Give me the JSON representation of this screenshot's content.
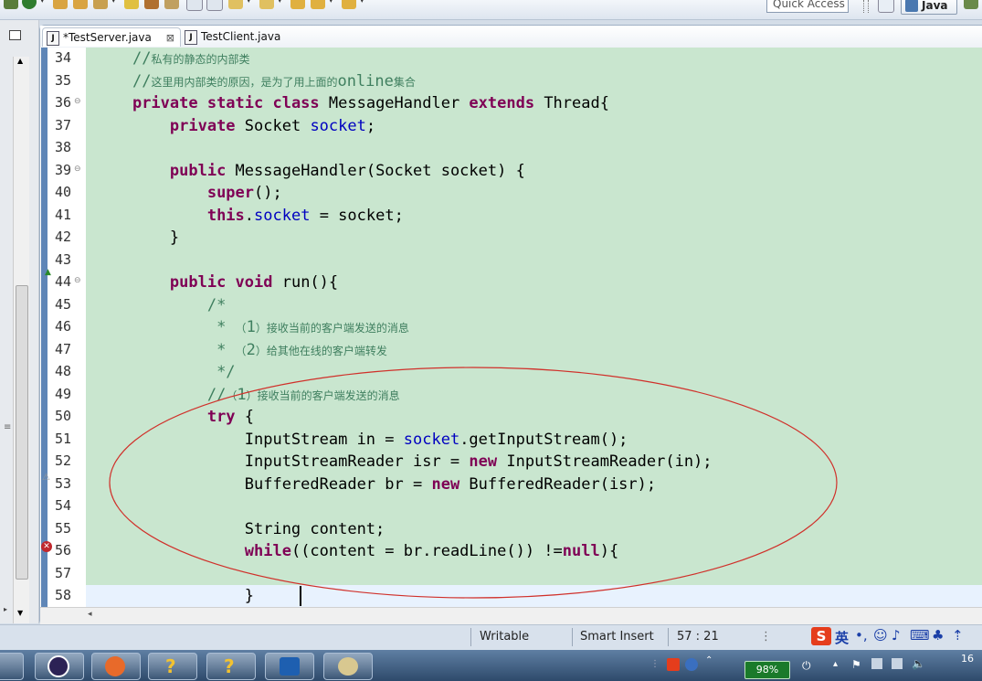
{
  "toolbar": {
    "quick_access": "Quick Access",
    "perspective_label": "Java"
  },
  "tabs": [
    {
      "label": "*TestServer.java",
      "close": "⊠"
    },
    {
      "label": "TestClient.java"
    }
  ],
  "code_lines": [
    {
      "n": "34",
      "fold": "",
      "segs": [
        {
          "t": "    "
        },
        {
          "t": "//",
          "c": "cm"
        },
        {
          "t": "私有的静态的内部类",
          "c": "cmcn"
        }
      ]
    },
    {
      "n": "35",
      "fold": "",
      "segs": [
        {
          "t": "    "
        },
        {
          "t": "//",
          "c": "cm"
        },
        {
          "t": "这里用内部类的原因，是为了用上面的",
          "c": "cmcn"
        },
        {
          "t": "online",
          "c": "cm"
        },
        {
          "t": "集合",
          "c": "cmcn"
        }
      ]
    },
    {
      "n": "36",
      "fold": "⊖",
      "segs": [
        {
          "t": "    "
        },
        {
          "t": "private static class",
          "c": "kw"
        },
        {
          "t": " MessageHandler "
        },
        {
          "t": "extends",
          "c": "kw"
        },
        {
          "t": " Thread{"
        }
      ]
    },
    {
      "n": "37",
      "fold": "",
      "segs": [
        {
          "t": "        "
        },
        {
          "t": "private",
          "c": "kw"
        },
        {
          "t": " Socket "
        },
        {
          "t": "socket",
          "c": "fld"
        },
        {
          "t": ";"
        }
      ]
    },
    {
      "n": "38",
      "fold": "",
      "segs": [
        {
          "t": ""
        }
      ]
    },
    {
      "n": "39",
      "fold": "⊖",
      "segs": [
        {
          "t": "        "
        },
        {
          "t": "public",
          "c": "kw"
        },
        {
          "t": " MessageHandler(Socket socket) {"
        }
      ]
    },
    {
      "n": "40",
      "fold": "",
      "segs": [
        {
          "t": "            "
        },
        {
          "t": "super",
          "c": "kw"
        },
        {
          "t": "();"
        }
      ]
    },
    {
      "n": "41",
      "fold": "",
      "segs": [
        {
          "t": "            "
        },
        {
          "t": "this",
          "c": "kw"
        },
        {
          "t": "."
        },
        {
          "t": "socket",
          "c": "fld"
        },
        {
          "t": " = socket;"
        }
      ]
    },
    {
      "n": "42",
      "fold": "",
      "segs": [
        {
          "t": "        }"
        }
      ]
    },
    {
      "n": "43",
      "fold": "",
      "segs": [
        {
          "t": ""
        }
      ]
    },
    {
      "n": "44",
      "fold": "⊖",
      "segs": [
        {
          "t": "        "
        },
        {
          "t": "public void",
          "c": "kw"
        },
        {
          "t": " run(){"
        }
      ]
    },
    {
      "n": "45",
      "fold": "",
      "segs": [
        {
          "t": "            "
        },
        {
          "t": "/*",
          "c": "cm"
        }
      ]
    },
    {
      "n": "46",
      "fold": "",
      "segs": [
        {
          "t": "             "
        },
        {
          "t": "* ",
          "c": "cm"
        },
        {
          "t": "（",
          "c": "cmcn"
        },
        {
          "t": "1",
          "c": "cm"
        },
        {
          "t": "）接收当前的客户端发送的消息",
          "c": "cmcn"
        }
      ]
    },
    {
      "n": "47",
      "fold": "",
      "segs": [
        {
          "t": "             "
        },
        {
          "t": "* ",
          "c": "cm"
        },
        {
          "t": "（",
          "c": "cmcn"
        },
        {
          "t": "2",
          "c": "cm"
        },
        {
          "t": "）给其他在线的客户端转发",
          "c": "cmcn"
        }
      ]
    },
    {
      "n": "48",
      "fold": "",
      "segs": [
        {
          "t": "             "
        },
        {
          "t": "*/",
          "c": "cm"
        }
      ]
    },
    {
      "n": "49",
      "fold": "",
      "segs": [
        {
          "t": "            "
        },
        {
          "t": "//",
          "c": "cm"
        },
        {
          "t": "（",
          "c": "cmcn"
        },
        {
          "t": "1",
          "c": "cm"
        },
        {
          "t": "）接收当前的客户端发送的消息",
          "c": "cmcn"
        }
      ]
    },
    {
      "n": "50",
      "fold": "",
      "segs": [
        {
          "t": "            "
        },
        {
          "t": "try",
          "c": "kw"
        },
        {
          "t": " {"
        }
      ]
    },
    {
      "n": "51",
      "fold": "",
      "segs": [
        {
          "t": "                InputStream in = "
        },
        {
          "t": "socket",
          "c": "fld"
        },
        {
          "t": ".getInputStream();"
        }
      ]
    },
    {
      "n": "52",
      "fold": "",
      "segs": [
        {
          "t": "                InputStreamReader isr = "
        },
        {
          "t": "new",
          "c": "kw"
        },
        {
          "t": " InputStreamReader(in);"
        }
      ]
    },
    {
      "n": "53",
      "fold": "",
      "segs": [
        {
          "t": "                BufferedReader br = "
        },
        {
          "t": "new",
          "c": "kw"
        },
        {
          "t": " BufferedReader(isr);"
        }
      ]
    },
    {
      "n": "54",
      "fold": "",
      "segs": [
        {
          "t": ""
        }
      ]
    },
    {
      "n": "55",
      "fold": "",
      "segs": [
        {
          "t": "                String content;"
        }
      ]
    },
    {
      "n": "56",
      "fold": "",
      "segs": [
        {
          "t": "                "
        },
        {
          "t": "while",
          "c": "kw"
        },
        {
          "t": "((content = br.readLine()) !="
        },
        {
          "t": "null",
          "c": "kw"
        },
        {
          "t": "){"
        }
      ]
    },
    {
      "n": "57",
      "fold": "",
      "segs": [
        {
          "t": ""
        }
      ]
    },
    {
      "n": "58",
      "fold": "",
      "segs": [
        {
          "t": "                }"
        }
      ]
    }
  ],
  "status": {
    "writable": "Writable",
    "insert_mode": "Smart Insert",
    "position": "57 : 21"
  },
  "ime": {
    "lang": "英"
  },
  "tray": {
    "battery": "98%",
    "clock": "16"
  },
  "colors": {
    "editor_bg": "#c9e6cf",
    "keyword": "#7f0055",
    "comment": "#3f7f5f",
    "field": "#0000c0",
    "annotation_ellipse": "#d0302a"
  }
}
